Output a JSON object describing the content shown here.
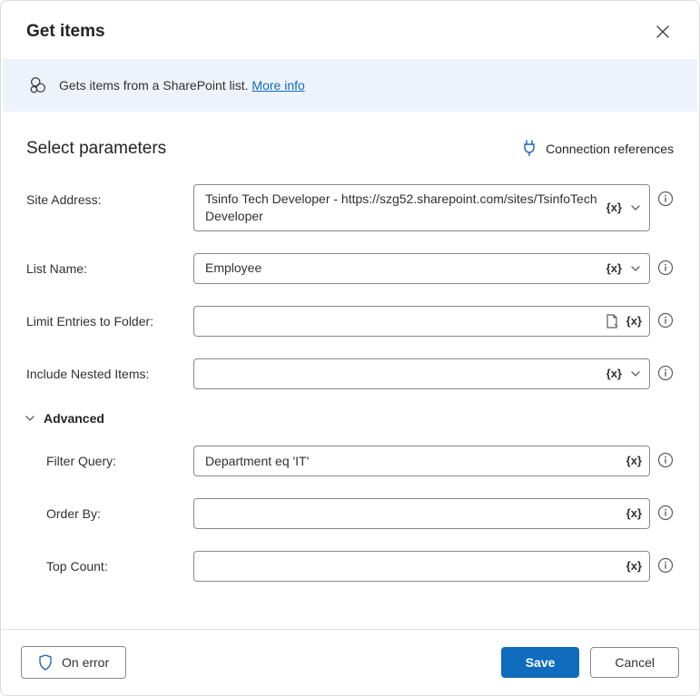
{
  "header": {
    "title": "Get items"
  },
  "banner": {
    "text": "Gets items from a SharePoint list.",
    "link": "More info"
  },
  "section": {
    "title": "Select parameters",
    "connection_references": "Connection references"
  },
  "fx_label": "{x}",
  "fields": {
    "site_address": {
      "label": "Site Address:",
      "value": "Tsinfo Tech Developer - https://szg52.sharepoint.com/sites/TsinfoTechDeveloper"
    },
    "list_name": {
      "label": "List Name:",
      "value": "Employee"
    },
    "limit_folder": {
      "label": "Limit Entries to Folder:",
      "value": ""
    },
    "include_nested": {
      "label": "Include Nested Items:",
      "value": ""
    }
  },
  "advanced": {
    "title": "Advanced",
    "filter_query": {
      "label": "Filter Query:",
      "value": "Department eq 'IT'"
    },
    "order_by": {
      "label": "Order By:",
      "value": ""
    },
    "top_count": {
      "label": "Top Count:",
      "value": ""
    }
  },
  "footer": {
    "on_error": "On error",
    "save": "Save",
    "cancel": "Cancel"
  }
}
